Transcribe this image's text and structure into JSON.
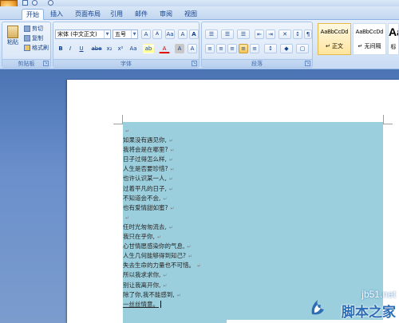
{
  "colors": {
    "ribbon_bg": "#d6e5f7",
    "tab_text": "#15428b",
    "document_bg": "#7b9ccd",
    "selection": "#9ccfdd",
    "watermark_blue": "#2d6db5"
  },
  "quick_access": {
    "icons": [
      "office-button-icon",
      "save-icon",
      "undo-icon",
      "redo-icon"
    ]
  },
  "tabs": [
    "开始",
    "插入",
    "页面布局",
    "引用",
    "邮件",
    "审阅",
    "视图"
  ],
  "clipboard": {
    "paste_label": "粘贴",
    "cut_label": "剪切",
    "copy_label": "复制",
    "format_painter_label": "格式刷",
    "group_label": "剪贴板"
  },
  "font": {
    "font_name": "宋体 (中文正文)",
    "font_size": "五号",
    "group_label": "字体",
    "row1_buttons": [
      "A",
      "A",
      "Aa",
      "A"
    ],
    "row2_buttons": [
      "B",
      "I",
      "U",
      "abe",
      "x₂",
      "x²",
      "Aa",
      "ab",
      "A",
      "A",
      "A"
    ]
  },
  "paragraph": {
    "group_label": "段落"
  },
  "styles": {
    "items": [
      {
        "sample": "AaBbCcDd",
        "name": "↵ 正文"
      },
      {
        "sample": "AaBbCcDd",
        "name": "↵ 无间隔"
      },
      {
        "sample": "Aa",
        "name": "标"
      }
    ]
  },
  "document": {
    "lines": [
      "",
      "如果没有遇见你,",
      "我将会是在哪里?",
      "日子过得怎么样,",
      "人生是否要珍惜?",
      "也许认识某一人,",
      "过着平凡的日子,",
      "不知道会不会,",
      "也有爱情甜如蜜?",
      "",
      "任时光匆匆流去,",
      "我只在乎你,",
      "心甘情愿感染你的气息,",
      "人生几何能够得到知己?",
      "失去生命的力量也不可惜。",
      "所以我求求你,",
      "别让我离开你,",
      "除了你,我不能感到,",
      "一丝丝情意。"
    ],
    "paragraph_mark": "↵"
  },
  "watermark": {
    "url": "jb51.net",
    "name": "脚本之家"
  }
}
